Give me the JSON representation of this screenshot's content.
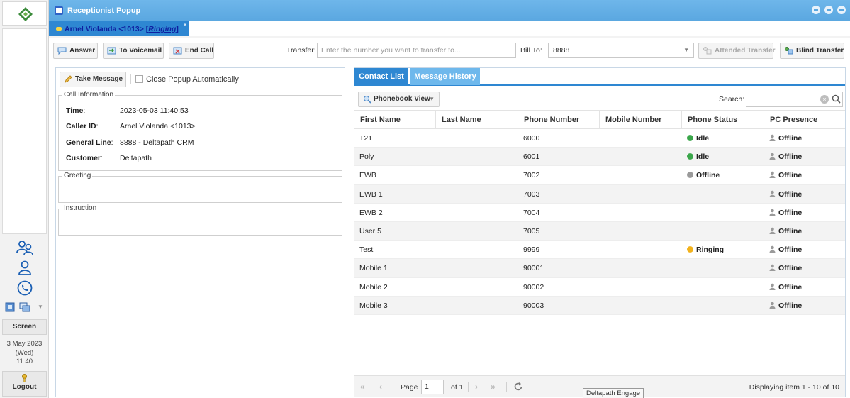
{
  "rail": {
    "nav_icons": [
      "contacts-group-icon",
      "contact-icon",
      "phone-icon"
    ],
    "screen_label": "Screen",
    "date_line1": "3 May 2023",
    "date_line2": "(Wed)",
    "time": "11:40",
    "logout_label": "Logout"
  },
  "window": {
    "title": "Receptionist Popup",
    "controls": [
      "minimize-icon",
      "restore-icon",
      "close-icon"
    ]
  },
  "call_tab": {
    "caller": "Arnel Violanda <1013>",
    "state_open": "[",
    "state": "Ringing",
    "state_close": "]",
    "close": "×"
  },
  "toolbar": {
    "answer": "Answer",
    "to_voicemail": "To Voicemail",
    "end_call": "End Call",
    "transfer_label": "Transfer:",
    "transfer_placeholder": "Enter the number you want to transfer to...",
    "bill_to_label": "Bill To:",
    "bill_to_value": "8888",
    "attended_transfer": "Attended Transfer",
    "blind_transfer": "Blind Transfer"
  },
  "left_panel": {
    "take_message": "Take Message",
    "close_popup_auto": "Close Popup Automatically",
    "call_info_legend": "Call Information",
    "call_info": [
      {
        "key": "Time",
        "value": "2023-05-03 11:40:53"
      },
      {
        "key": "Caller ID",
        "value": "Arnel Violanda <1013>"
      },
      {
        "key": "General Line",
        "value": "8888 - Deltapath CRM"
      },
      {
        "key": "Customer",
        "value": "Deltapath"
      }
    ],
    "greeting_legend": "Greeting",
    "instruction_legend": "Instruction"
  },
  "right_panel": {
    "tabs": [
      "Contact List",
      "Message History"
    ],
    "active_tab": "Contact List",
    "phonebook_view": "Phonebook View",
    "search_label": "Search:",
    "columns": [
      "First Name",
      "Last Name",
      "Phone Number",
      "Mobile Number",
      "Phone Status",
      "PC Presence"
    ],
    "rows": [
      {
        "first": "T21",
        "last": "",
        "phone": "6000",
        "mobile": "",
        "status": "Idle",
        "status_color": "#3aa64a",
        "presence": "Offline"
      },
      {
        "first": "Poly",
        "last": "",
        "phone": "6001",
        "mobile": "",
        "status": "Idle",
        "status_color": "#3aa64a",
        "presence": "Offline"
      },
      {
        "first": "EWB",
        "last": "",
        "phone": "7002",
        "mobile": "",
        "status": "Offline",
        "status_color": "#9a9a9a",
        "presence": "Offline"
      },
      {
        "first": "EWB 1",
        "last": "",
        "phone": "7003",
        "mobile": "",
        "status": "",
        "status_color": "",
        "presence": "Offline"
      },
      {
        "first": "EWB 2",
        "last": "",
        "phone": "7004",
        "mobile": "",
        "status": "",
        "status_color": "",
        "presence": "Offline"
      },
      {
        "first": "User 5",
        "last": "",
        "phone": "7005",
        "mobile": "",
        "status": "",
        "status_color": "",
        "presence": "Offline"
      },
      {
        "first": "Test",
        "last": "",
        "phone": "9999",
        "mobile": "",
        "status": "Ringing",
        "status_color": "#f2b21c",
        "presence": "Offline"
      },
      {
        "first": "Mobile 1",
        "last": "",
        "phone": "90001",
        "mobile": "",
        "status": "",
        "status_color": "",
        "presence": "Offline"
      },
      {
        "first": "Mobile 2",
        "last": "",
        "phone": "90002",
        "mobile": "",
        "status": "",
        "status_color": "",
        "presence": "Offline"
      },
      {
        "first": "Mobile 3",
        "last": "",
        "phone": "90003",
        "mobile": "",
        "status": "",
        "status_color": "",
        "presence": "Offline"
      }
    ],
    "pager": {
      "page_label": "Page",
      "page_value": "1",
      "of_label": "of 1",
      "display_text": "Displaying item 1 - 10 of 10"
    }
  },
  "tooltip": "Deltapath Engage",
  "colors": {
    "accent": "#2e87d2",
    "title_bar": "#5aa7e0",
    "idle": "#3aa64a",
    "ringing": "#f2b21c"
  }
}
